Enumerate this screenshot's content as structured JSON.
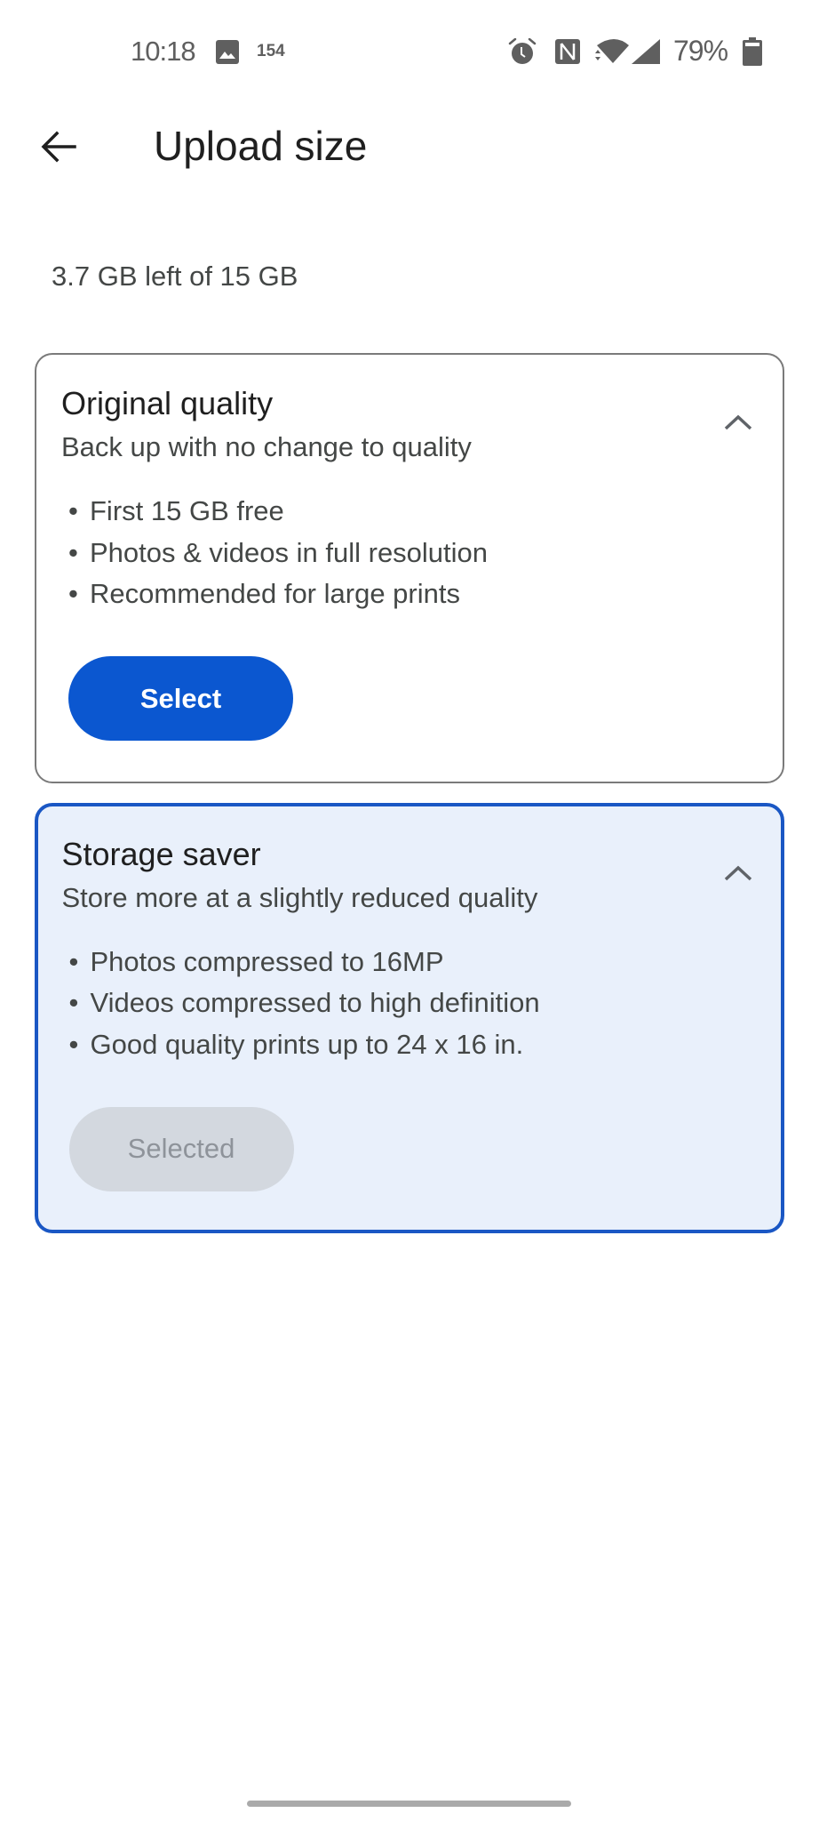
{
  "status_bar": {
    "time": "10:18",
    "notification_count": "154",
    "icons": [
      "image-icon",
      "alarm-icon",
      "nfc-icon",
      "wifi-icon",
      "cell-signal-icon",
      "battery-icon"
    ],
    "battery_percent": "79%"
  },
  "app_bar": {
    "back_icon": "arrow-back-icon",
    "title": "Upload size"
  },
  "storage": {
    "summary": "3.7 GB left of 15 GB"
  },
  "options": [
    {
      "title": "Original quality",
      "subtitle": "Back up with no change to quality",
      "bullets": [
        "First 15 GB free",
        "Photos & videos in full resolution",
        "Recommended for large prints"
      ],
      "button_label": "Select",
      "selected": false,
      "expanded": true
    },
    {
      "title": "Storage saver",
      "subtitle": "Store more at a slightly reduced quality",
      "bullets": [
        "Photos compressed to 16MP",
        "Videos compressed to high definition",
        "Good quality prints up to 24 x 16 in."
      ],
      "button_label": "Selected",
      "selected": true,
      "expanded": true
    }
  ],
  "bullet_char": "•",
  "colors": {
    "primary": "#0b57d0",
    "selected_border": "#1a57c4",
    "selected_bg": "#e9f0fb",
    "disabled_bg": "#d3d8df",
    "disabled_text": "#8e939a",
    "card_border": "#7a7a7a"
  }
}
